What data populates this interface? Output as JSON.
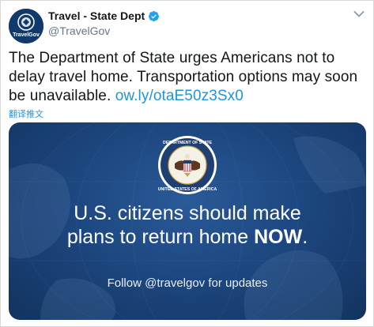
{
  "account": {
    "display_name": "Travel - State Dept",
    "handle": "@TravelGov",
    "avatar_caption": "TravelGov"
  },
  "tweet": {
    "text": "The Department of State urges Americans not to delay travel home. Transportation options may soon be unavailable. ",
    "link": "ow.ly/otaE50z3Sx0",
    "translate": "翻译推文"
  },
  "media": {
    "headline_line1": "U.S. citizens should make",
    "headline_line2_prefix": "plans to return home ",
    "headline_line2_emphasis": "NOW",
    "headline_line2_suffix": ".",
    "subline": "Follow @travelgov for updates",
    "seal_text_top": "DEPARTMENT OF STATE",
    "seal_text_bottom": "UNITED STATES OF AMERICA"
  },
  "colors": {
    "link": "#1b95e0",
    "verified": "#1da1f2",
    "media_bg": "#1d4780"
  },
  "icons": [
    "verified-badge-icon",
    "chevron-down-icon",
    "state-seal-icon"
  ]
}
